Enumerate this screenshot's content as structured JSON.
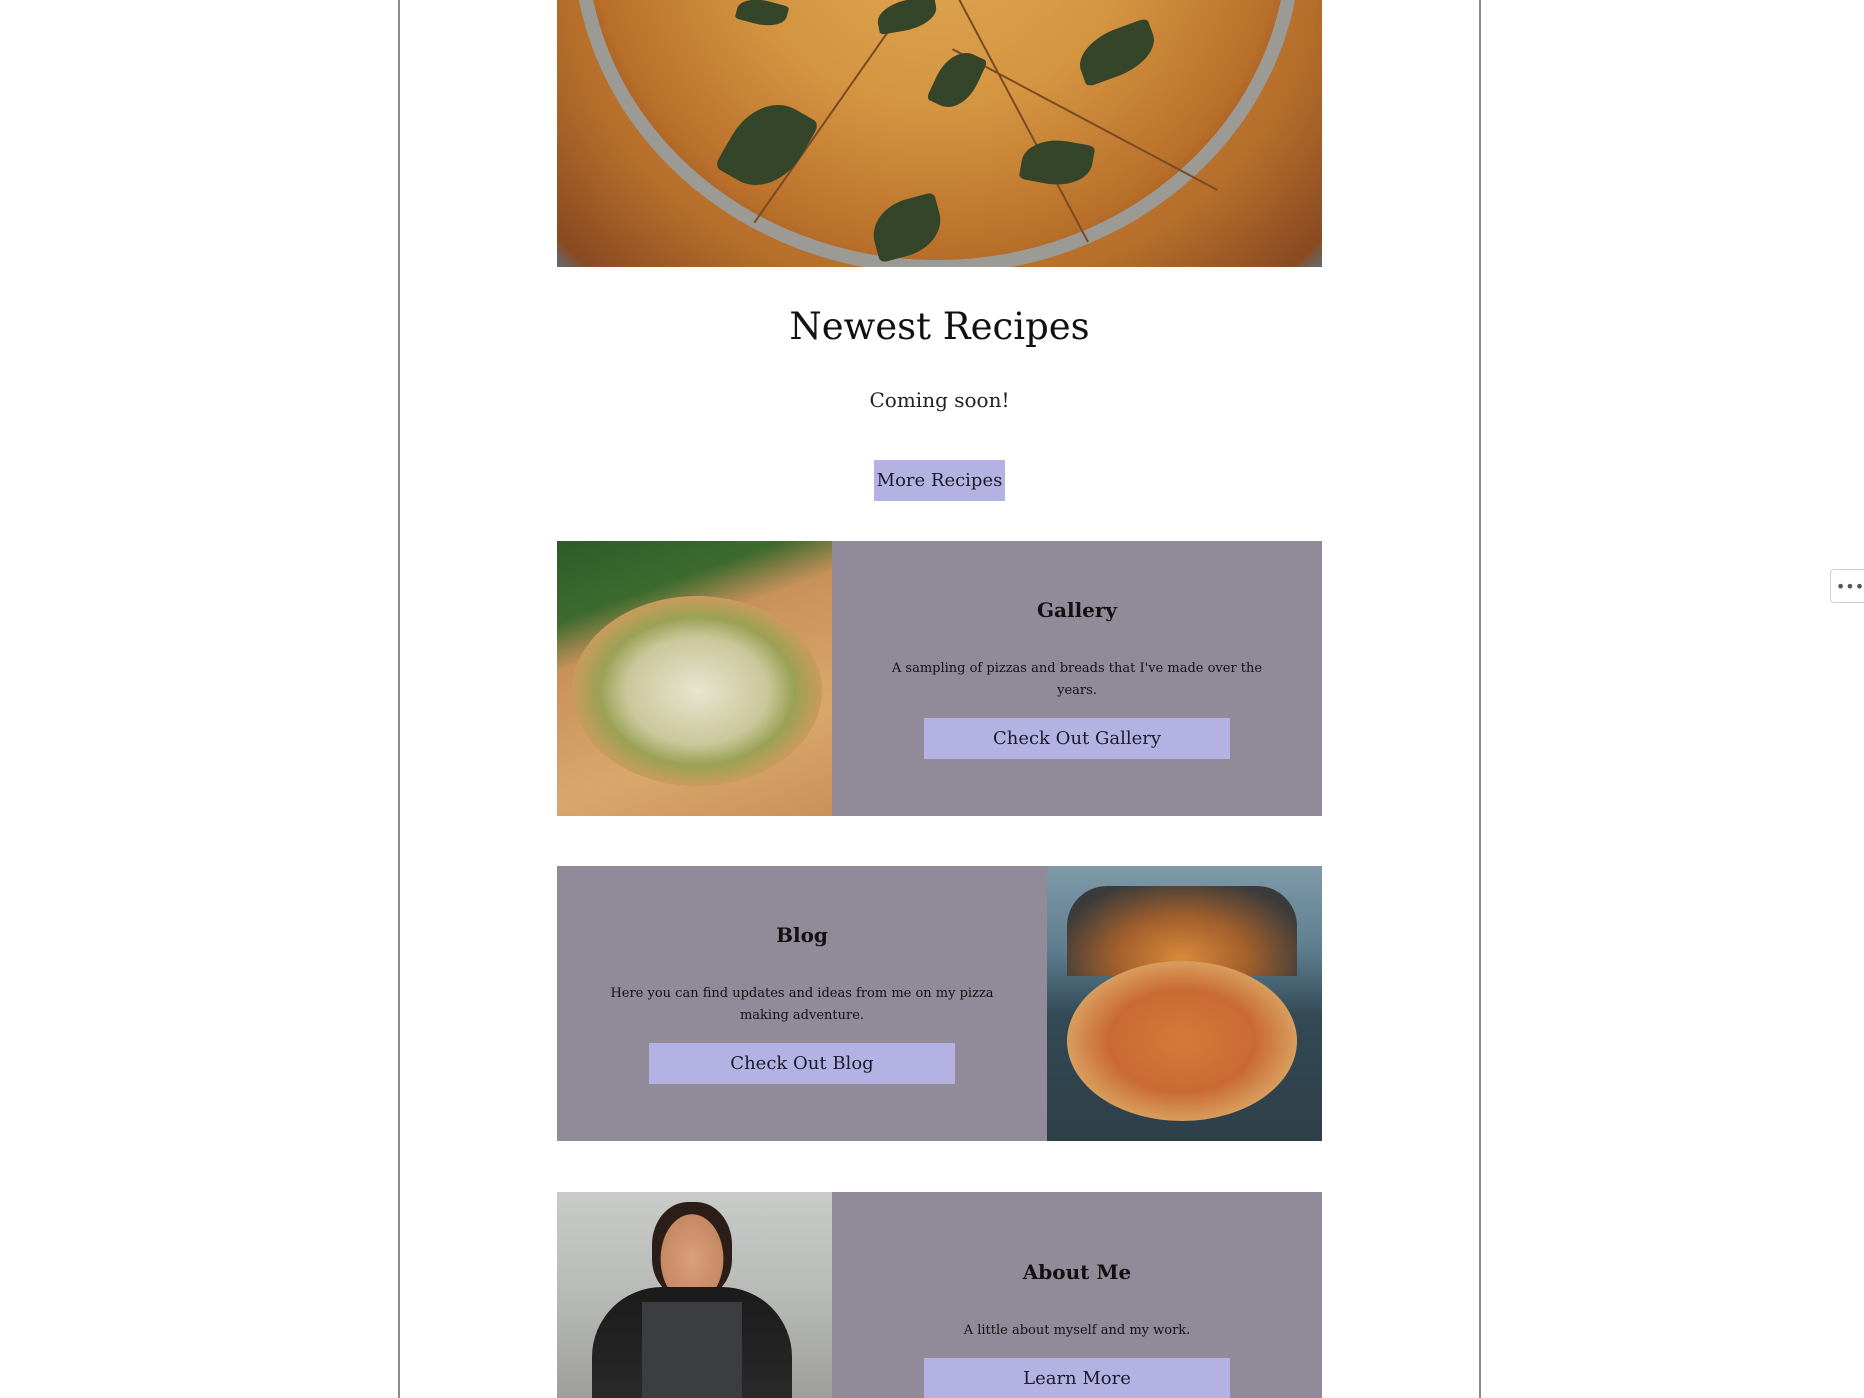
{
  "newest_recipes": {
    "title": "Newest Recipes",
    "subtitle": "Coming soon!",
    "button_label": "More Recipes"
  },
  "cards": {
    "gallery": {
      "title": "Gallery",
      "description": "A sampling of pizzas and breads that I've made over the years.",
      "button_label": "Check Out Gallery"
    },
    "blog": {
      "title": "Blog",
      "description": "Here you can find updates and ideas from me on my pizza making adventure.",
      "button_label": "Check Out Blog"
    },
    "about": {
      "title": "About Me",
      "description": "A little about myself and my work.",
      "button_label": "Learn More"
    }
  },
  "side_menu": {
    "icon": "ellipsis-icon",
    "glyph": "•••"
  },
  "colors": {
    "card_background": "#918b99",
    "button_background": "#b4b2e3",
    "frame_line": "#8a8a96"
  }
}
